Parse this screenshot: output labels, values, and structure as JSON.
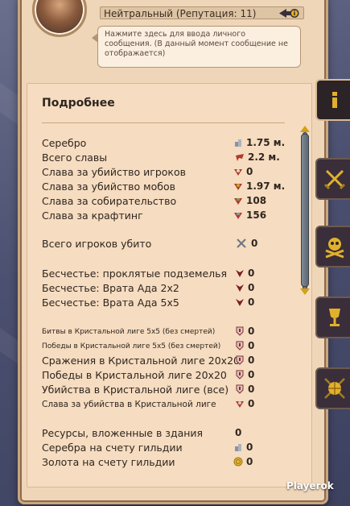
{
  "header": {
    "reputation": "Нейтральный (Репутация: 11)",
    "message_hint": "Нажмите здесь для ввода личного сообщения. (В данный момент сообщение не отображается)"
  },
  "panel": {
    "title": "Подробнее",
    "rows": [
      {
        "label": "Серебро",
        "icon": "silver-icon",
        "value": "1.75 м."
      },
      {
        "label": "Всего славы",
        "icon": "fame-icon",
        "value": "2.2 м."
      },
      {
        "label": "Слава за убийство игроков",
        "icon": "pvp-fame-icon",
        "value": "0"
      },
      {
        "label": "Слава за убийство мобов",
        "icon": "pve-fame-icon",
        "value": "1.97 м."
      },
      {
        "label": "Слава за собирательство",
        "icon": "gather-fame-icon",
        "value": "108"
      },
      {
        "label": "Слава за крафтинг",
        "icon": "craft-fame-icon",
        "value": "156"
      },
      {
        "label": "Всего игроков убито",
        "icon": "swords-icon",
        "value": "0"
      },
      {
        "label": "Бесчестье: проклятые подземелья",
        "icon": "infamy-icon",
        "value": "0"
      },
      {
        "label": "Бесчестье: Врата Ада 2x2",
        "icon": "infamy-icon",
        "value": "0"
      },
      {
        "label": "Бесчестье: Врата Ада 5x5",
        "icon": "infamy-icon",
        "value": "0"
      },
      {
        "label": "Битвы в Кристальной лиге 5х5 (без смертей)",
        "icon": "crystal-icon",
        "value": "0"
      },
      {
        "label": "Победы в Кристальной лиге 5х5 (без смертей)",
        "icon": "crystal-icon",
        "value": "0"
      },
      {
        "label": "Сражения в Кристальной лиге 20х20",
        "icon": "crystal-icon",
        "value": "0"
      },
      {
        "label": "Победы в Кристальной лиге 20х20",
        "icon": "crystal-icon",
        "value": "0"
      },
      {
        "label": "Убийства в Кристальной лиге (все)",
        "icon": "crystal-icon",
        "value": "0"
      },
      {
        "label": "Слава за убийства в Кристальной лиге",
        "icon": "crystal-fame-icon",
        "value": "0"
      },
      {
        "label": "Ресурсы, вложенные в здания",
        "icon": "",
        "value": "0"
      },
      {
        "label": "Серебра на счету гильдии",
        "icon": "silver-icon",
        "value": "0"
      },
      {
        "label": "Золота на счету гильдии",
        "icon": "gold-icon",
        "value": "0"
      }
    ]
  },
  "tabs": [
    {
      "name": "info-tab",
      "icon": "info-icon",
      "active": true
    },
    {
      "name": "combat-tab",
      "icon": "crossed-swords-icon"
    },
    {
      "name": "skull-tab",
      "icon": "skull-crossbones-icon"
    },
    {
      "name": "trophy-tab",
      "icon": "chalice-icon"
    },
    {
      "name": "guild-tab",
      "icon": "globe-swords-icon"
    }
  ],
  "watermark": "Playerok",
  "colors": {
    "parchment": "#f6dcc0",
    "text": "#2f2620",
    "frame": "#c9a57f",
    "tab_dark": "#2b2326",
    "accent_gold": "#d4a017"
  }
}
